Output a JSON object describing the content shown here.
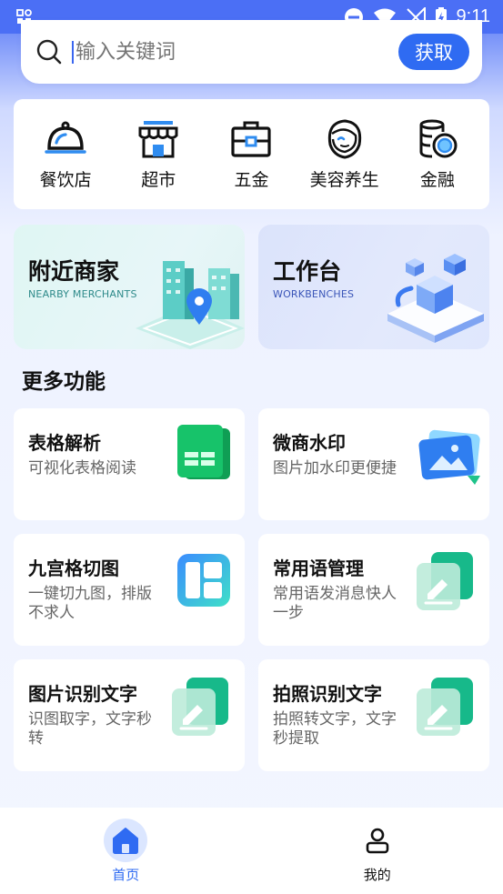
{
  "status_bar": {
    "time": "9:11"
  },
  "search": {
    "placeholder": "输入关键词",
    "button_label": "获取"
  },
  "categories": [
    {
      "label": "餐饮店",
      "icon": "bell-cloche-icon"
    },
    {
      "label": "超市",
      "icon": "storefront-icon"
    },
    {
      "label": "五金",
      "icon": "toolbox-icon"
    },
    {
      "label": "美容养生",
      "icon": "woman-face-icon"
    },
    {
      "label": "金融",
      "icon": "coins-icon"
    }
  ],
  "feature_cards": [
    {
      "title": "附近商家",
      "subtitle": "NEARBY MERCHANTS"
    },
    {
      "title": "工作台",
      "subtitle": "WORKBENCHES"
    }
  ],
  "more_section": {
    "title": "更多功能"
  },
  "functions": [
    {
      "title": "表格解析",
      "desc": "可视化表格阅读",
      "icon": "spreadsheet-icon"
    },
    {
      "title": "微商水印",
      "desc": "图片加水印更便捷",
      "icon": "image-watermark-icon"
    },
    {
      "title": "九宫格切图",
      "desc": "一键切九图，排版不求人",
      "icon": "grid-layout-icon"
    },
    {
      "title": "常用语管理",
      "desc": "常用语发消息快人一步",
      "icon": "edit-note-icon"
    },
    {
      "title": "图片识别文字",
      "desc": "识图取字，文字秒转",
      "icon": "edit-note-icon"
    },
    {
      "title": "拍照识别文字",
      "desc": "拍照转文字，文字秒提取",
      "icon": "edit-note-icon"
    }
  ],
  "tabbar": [
    {
      "label": "首页",
      "icon": "home-icon",
      "active": true
    },
    {
      "label": "我的",
      "icon": "user-icon",
      "active": false
    }
  ],
  "colors": {
    "accent": "#2f6bf2",
    "status_bar": "#4b6ff5",
    "text_secondary": "#666666"
  }
}
